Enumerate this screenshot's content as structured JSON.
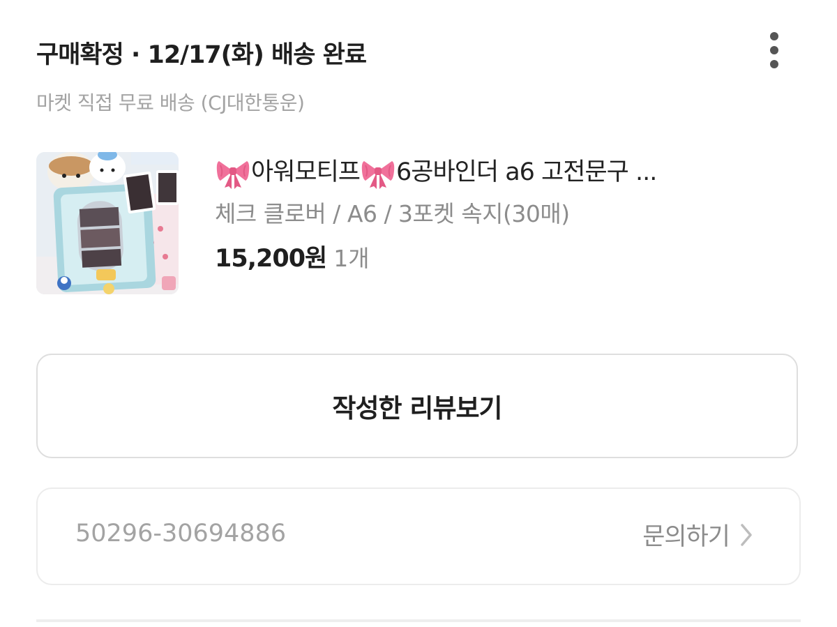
{
  "status": {
    "title": "구매확정 · 12/17(화) 배송 완료",
    "more_icon": "more-vertical-icon"
  },
  "shipping": {
    "text": "마켓 직접 무료 배송 (CJ대한통운)"
  },
  "product": {
    "name_part1": "아워모티프",
    "name_part2": "6공바인더 a6 고전문구 ...",
    "ribbon_icon": "ribbon-emoji",
    "option": "체크 클로버 / A6 / 3포켓 속지(30매)",
    "price": "15,200원",
    "quantity": "1개",
    "thumbnail_icon": "product-photo"
  },
  "review_button": {
    "label": "작성한 리뷰보기"
  },
  "order": {
    "number": "50296-30694886",
    "inquiry_label": "문의하기",
    "chevron_icon": "chevron-right-icon"
  },
  "colors": {
    "primary_text": "#1f1f1f",
    "secondary_text": "#a3a3a3",
    "border": "#dedede",
    "ribbon": "#f0709a"
  }
}
